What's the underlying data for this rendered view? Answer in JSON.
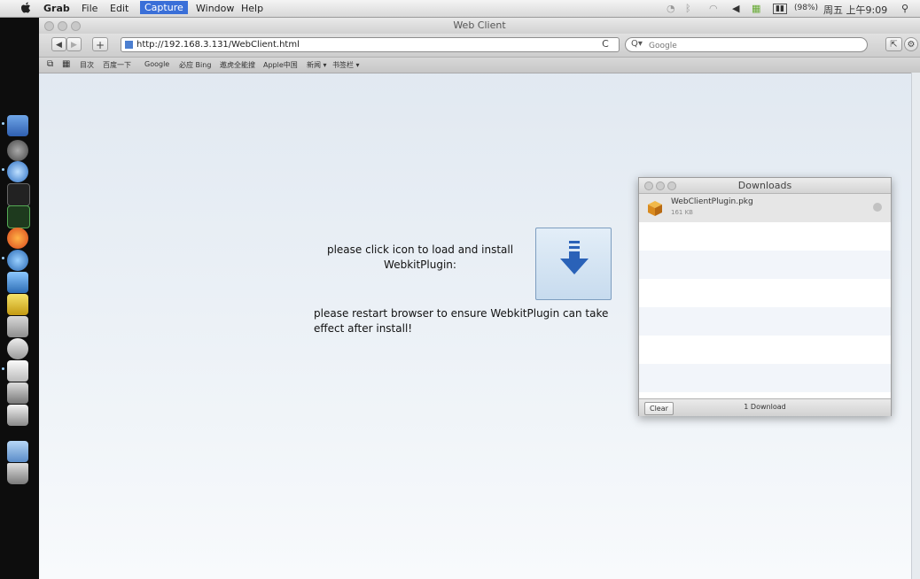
{
  "menubar": {
    "items": [
      "Grab",
      "File",
      "Edit",
      "Capture",
      "Window",
      "Help"
    ],
    "active_item": "Capture",
    "status_battery": "(98%)",
    "status_clock": "周五 上午9:09",
    "accent": "#3a6fd8"
  },
  "window": {
    "title": "Web Client"
  },
  "toolbar": {
    "back_label": "◀",
    "forward_label": "▶",
    "add_label": "+",
    "url": "http://192.168.3.131/WebClient.html",
    "reload_label": "C",
    "search_prefix": "Q▾",
    "search_placeholder": "Google"
  },
  "bookmarks": {
    "items": [
      "目次",
      "百度一下",
      "Google",
      "必应 Bing",
      "遨虎全能搜",
      "Apple中国",
      "新闻 ▾",
      "书签栏 ▾"
    ]
  },
  "content": {
    "install_message": "please click icon to load and install WebkitPlugin:",
    "restart_message": "please restart browser to ensure WebkitPlugin can take effect after install!",
    "button_color": "#2a62b8"
  },
  "downloads": {
    "title": "Downloads",
    "items": [
      {
        "filename": "WebClientPlugin.pkg",
        "size": "161 KB"
      }
    ],
    "clear_label": "Clear",
    "count_label": "1 Download"
  }
}
